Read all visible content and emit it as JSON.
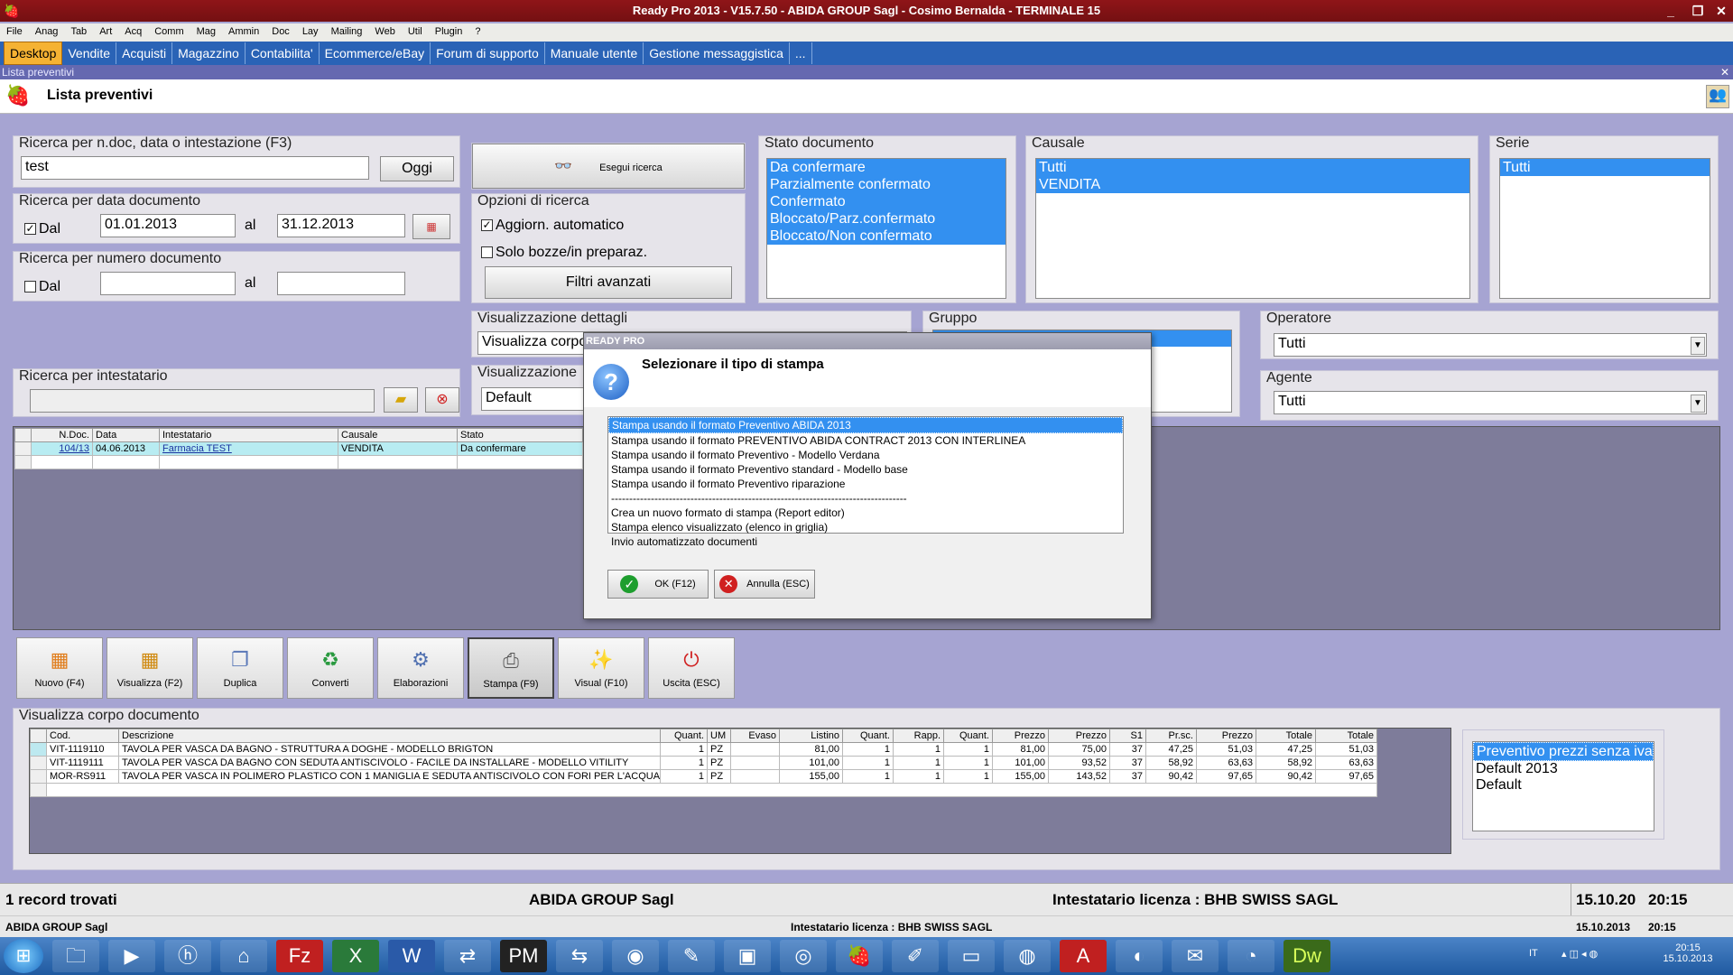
{
  "window": {
    "title": "Ready Pro 2013 - V15.7.50 - ABIDA GROUP Sagl - Cosimo Bernalda - TERMINALE 15"
  },
  "menu": [
    "File",
    "Anag",
    "Tab",
    "Art",
    "Acq",
    "Comm",
    "Mag",
    "Ammin",
    "Doc",
    "Lay",
    "Mailing",
    "Web",
    "Util",
    "Plugin",
    "?"
  ],
  "tabs": [
    "Desktop",
    "Vendite",
    "Acquisti",
    "Magazzino",
    "Contabilita'",
    "Ecommerce/eBay",
    "Forum di supporto",
    "Manuale utente",
    "Gestione messaggistica",
    "..."
  ],
  "subwindow": "Lista preventivi",
  "page_title": "Lista preventivi",
  "search": {
    "label": "Ricerca per n.doc, data o intestazione (F3)",
    "value": "test",
    "today_btn": "Oggi",
    "run_btn": "Esegui ricerca",
    "date_label": "Ricerca per data documento",
    "date_from_label": "Dal",
    "date_from": "01.01.2013",
    "date_to_label": "al",
    "date_to": "31.12.2013",
    "num_label": "Ricerca per numero documento",
    "num_from_label": "Dal",
    "num_to_label": "al",
    "owner_label": "Ricerca per intestatario"
  },
  "options": {
    "label": "Opzioni di ricerca",
    "auto": "Aggiorn. automatico",
    "drafts": "Solo bozze/in preparaz.",
    "advanced": "Filtri avanzati"
  },
  "stato": {
    "label": "Stato documento",
    "items": [
      "Da confermare",
      "Parzialmente confermato",
      "Confermato",
      "Bloccato/Parz.confermato",
      "Bloccato/Non confermato"
    ]
  },
  "causale": {
    "label": "Causale",
    "items": [
      "Tutti",
      "VENDITA"
    ]
  },
  "serie": {
    "label": "Serie",
    "items": [
      "Tutti"
    ]
  },
  "dettagli": {
    "label": "Visualizzazione dettagli",
    "value": "Visualizza corpo"
  },
  "visualizzazione": {
    "label": "Visualizzazione",
    "value": "Default"
  },
  "gruppo": {
    "label": "Gruppo"
  },
  "operatore": {
    "label": "Operatore",
    "value": "Tutti"
  },
  "agente": {
    "label": "Agente",
    "value": "Tutti"
  },
  "doc_grid": {
    "headers": [
      "N.Doc.",
      "Data",
      "Intestatario",
      "Causale",
      "Stato"
    ],
    "rows": [
      [
        "104/13",
        "04.06.2013",
        "Farmacia TEST",
        "VENDITA",
        "Da confermare"
      ]
    ]
  },
  "dialog": {
    "title": "READY PRO",
    "question": "Selezionare il tipo di stampa",
    "options": [
      "Stampa usando il formato Preventivo ABIDA 2013",
      "Stampa usando il formato PREVENTIVO ABIDA CONTRACT 2013 CON INTERLINEA",
      "Stampa usando il formato Preventivo - Modello Verdana",
      "Stampa usando il formato Preventivo standard - Modello base",
      "Stampa usando il formato Preventivo riparazione",
      "----------------------------------------------------------------------------------",
      "Crea un nuovo formato di stampa (Report editor)",
      "Stampa elenco visualizzato (elenco in griglia)",
      "Invio automatizzato documenti"
    ],
    "ok": "OK (F12)",
    "cancel": "Annulla (ESC)"
  },
  "toolbar": [
    "Nuovo (F4)",
    "Visualizza (F2)",
    "Duplica",
    "Converti",
    "Elaborazioni",
    "Stampa (F9)",
    "Visual (F10)",
    "Uscita (ESC)"
  ],
  "body_section": {
    "label": "Visualizza corpo documento"
  },
  "body_grid": {
    "headers": [
      "Cod.",
      "Descrizione",
      "Quant.",
      "UM",
      "Evaso",
      "Listino",
      "Quant.",
      "Rapp.",
      "Quant.",
      "Prezzo",
      "Prezzo",
      "S1",
      "Pr.sc.",
      "Prezzo",
      "Totale",
      "Totale"
    ],
    "rows": [
      [
        "VIT-1119110",
        "TAVOLA PER VASCA DA BAGNO - STRUTTURA A DOGHE - MODELLO BRIGTON",
        "1",
        "PZ",
        "",
        "81,00",
        "1",
        "1",
        "1",
        "81,00",
        "75,00",
        "37",
        "47,25",
        "51,03",
        "47,25",
        "51,03"
      ],
      [
        "VIT-1119111",
        "TAVOLA PER VASCA DA BAGNO CON SEDUTA ANTISCIVOLO - FACILE DA INSTALLARE - MODELLO VITILITY",
        "1",
        "PZ",
        "",
        "101,00",
        "1",
        "1",
        "1",
        "101,00",
        "93,52",
        "37",
        "58,92",
        "63,63",
        "58,92",
        "63,63"
      ],
      [
        "MOR-RS911",
        "TAVOLA PER VASCA IN POLIMERO PLASTICO CON 1 MANIGLIA E SEDUTA ANTISCIVOLO CON FORI PER L'ACQUA - POR...",
        "1",
        "PZ",
        "",
        "155,00",
        "1",
        "1",
        "1",
        "155,00",
        "143,52",
        "37",
        "90,42",
        "97,65",
        "90,42",
        "97,65"
      ]
    ]
  },
  "layouts": [
    "Preventivo prezzi senza iva",
    "Default 2013",
    "Default"
  ],
  "status": {
    "records": "1 record trovati",
    "company": "ABIDA GROUP Sagl",
    "license": "Intestatario licenza : BHB SWISS SAGL",
    "date": "15.10.20",
    "time": "20:15"
  },
  "status2": {
    "company": "ABIDA GROUP Sagl",
    "license": "Intestatario licenza : BHB SWISS SAGL",
    "date": "15.10.2013",
    "time": "20:15"
  },
  "taskbar": {
    "lang": "IT",
    "time": "20:15",
    "date": "15.10.2013"
  }
}
